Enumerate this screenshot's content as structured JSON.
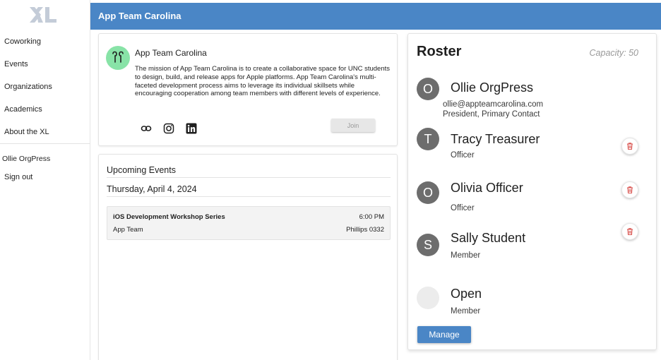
{
  "sidebar": {
    "logo_icon": "xl-logo-icon",
    "nav_items": [
      {
        "label": "Coworking"
      },
      {
        "label": "Events"
      },
      {
        "label": "Organizations"
      },
      {
        "label": "Academics"
      },
      {
        "label": "About the XL"
      }
    ],
    "user": {
      "name": "Ollie OrgPress",
      "sign_out": "Sign out"
    }
  },
  "header": {
    "title": "App Team Carolina",
    "color": "#4a86c6"
  },
  "organization": {
    "name": "App Team Carolina",
    "avatar_icon": "airpods-icon",
    "avatar_color": "#88e3a7",
    "description": "The mission of App Team Carolina is to create a collaborative space for UNC students to design, build, and release apps for Apple platforms. App Team Carolina's multi-faceted development process aims to leverage its individual skillsets while encouraging cooperation among team members with different levels of experience.",
    "links": [
      {
        "icon": "link-icon"
      },
      {
        "icon": "instagram-icon"
      },
      {
        "icon": "linkedin-icon"
      }
    ],
    "join_label": "Join"
  },
  "events": {
    "title": "Upcoming Events",
    "date": "Thursday, April 4, 2024",
    "items": [
      {
        "name": "iOS Development Workshop Series",
        "time": "6:00 PM",
        "organization": "App Team",
        "location": "Phillips 0332"
      }
    ]
  },
  "roster": {
    "title": "Roster",
    "capacity": "Capacity: 50",
    "members": [
      {
        "initial": "O",
        "name": "Ollie OrgPress",
        "email": "ollie@appteamcarolina.com",
        "role": "President, Primary Contact",
        "deletable": false
      },
      {
        "initial": "T",
        "name": "Tracy Treasurer",
        "role": "Officer",
        "deletable": true
      },
      {
        "initial": "O",
        "name": "Olivia Officer",
        "role": "Officer",
        "deletable": true
      },
      {
        "initial": "S",
        "name": "Sally Student",
        "role": "Member",
        "deletable": true
      },
      {
        "initial": "",
        "name": "Open",
        "role": "Member",
        "deletable": false
      }
    ],
    "manage_label": "Manage",
    "delete_icon": "trash-icon",
    "delete_color": "#d9534f"
  }
}
